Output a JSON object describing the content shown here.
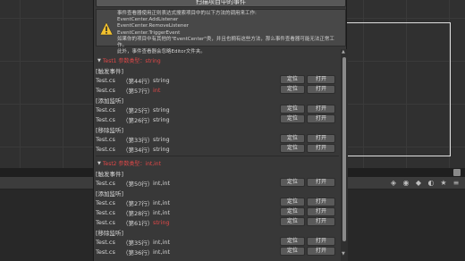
{
  "window": {
    "scan_button": "扫描项目中的事件",
    "help_text": "事件查看器使用正则表达式搜索项目中的以下方法的调用来工作:\nEventCenter.AddListener\nEventCenter.RemoveListener\nEventCenter.TriggerEvent\n如果你的项目中有其他的\"EventCenter\"类，并且也拥有这些方法，那么事件查看器可能无法正常工作。\n此外，事件查看器会忽略Editor文件夹。"
  },
  "colors": {
    "accent_red": "#e04848"
  },
  "labels": {
    "locate": "定位",
    "open": "打开"
  },
  "events": [
    {
      "header": "Test1 参数类型：string",
      "sections": [
        {
          "label": "[触发事件]",
          "rows": [
            {
              "file": "Test.cs",
              "line": "（第44行）",
              "type": "string",
              "type_red": false
            },
            {
              "file": "Test.cs",
              "line": "（第57行）",
              "type": "int",
              "type_red": true
            }
          ]
        },
        {
          "label": "[添加监听]",
          "rows": [
            {
              "file": "Test.cs",
              "line": "（第25行）",
              "type": "string",
              "type_red": false
            },
            {
              "file": "Test.cs",
              "line": "（第26行）",
              "type": "string",
              "type_red": false
            }
          ]
        },
        {
          "label": "[移除监听]",
          "rows": [
            {
              "file": "Test.cs",
              "line": "（第33行）",
              "type": "string",
              "type_red": false
            },
            {
              "file": "Test.cs",
              "line": "（第34行）",
              "type": "string",
              "type_red": false
            }
          ]
        }
      ]
    },
    {
      "header": "Test2 参数类型：int,int",
      "sections": [
        {
          "label": "[触发事件]",
          "rows": [
            {
              "file": "Test.cs",
              "line": "（第50行）",
              "type": "int,int",
              "type_red": false
            }
          ]
        },
        {
          "label": "[添加监听]",
          "rows": [
            {
              "file": "Test.cs",
              "line": "（第27行）",
              "type": "int,int",
              "type_red": false
            },
            {
              "file": "Test.cs",
              "line": "（第28行）",
              "type": "int,int",
              "type_red": false
            },
            {
              "file": "Test.cs",
              "line": "（第61行）",
              "type": "string",
              "type_red": true
            }
          ]
        },
        {
          "label": "[移除监听]",
          "rows": [
            {
              "file": "Test.cs",
              "line": "（第35行）",
              "type": "int,int",
              "type_red": false
            },
            {
              "file": "Test.cs",
              "line": "（第36行）",
              "type": "int,int",
              "type_red": false
            }
          ]
        }
      ]
    }
  ],
  "editor_toolbar_icons": [
    "gizmo-icon",
    "scene-visibility-icon",
    "tag-icon",
    "layer-icon",
    "star-icon",
    "hamburger-icon"
  ]
}
